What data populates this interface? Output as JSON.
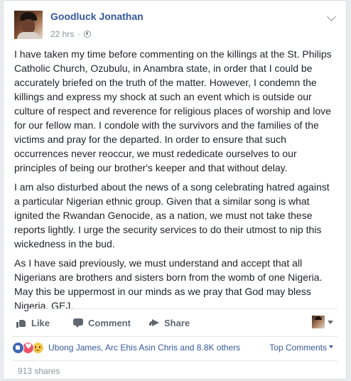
{
  "post": {
    "author": "Goodluck Jonathan",
    "time": "22 hrs",
    "separator": "·",
    "paragraphs": [
      "I have taken my time before commenting on the killings at the St. Philips Catholic Church, Ozubulu, in Anambra state, in order that I could be accurately briefed on the truth of the matter. However, I condemn the killings and express my shock at such an event which is outside our culture of respect and reverence for religious places of worship and love for our fellow man. I condole with the survivors and the families of the victims and pray for the departed. In order to ensure that such occurrences never reoccur, we must rededicate ourselves to our principles of being our brother's keeper and that without delay.",
      "I am also disturbed about the news of a song celebrating hatred against a particular Nigerian ethnic group. Given that a similar song is what ignited the Rwandan Genocide, as a nation, we must not take these reports lightly. I urge the security services to do their utmost to nip this wickedness in the bud.",
      "As I have said previously, we must understand and accept that all Nigerians are brothers and sisters born from the womb of one Nigeria. May this be uppermost in our minds as we pray that God may bless Nigeria. GEJ."
    ]
  },
  "actions": {
    "like": "Like",
    "comment": "Comment",
    "share": "Share"
  },
  "reactions": {
    "icons": [
      "like-reaction",
      "love-reaction",
      "sad-reaction"
    ],
    "summary": "Ubong James, Arc Ehis Asin Chris and 8.8K others",
    "sort_label": "Top Comments"
  },
  "shares": "913 shares",
  "colors": {
    "link": "#365899",
    "muted": "#90949c",
    "like_blue": "#4267b2",
    "love_red": "#f25268",
    "sad_yellow": "#f7c84b"
  }
}
